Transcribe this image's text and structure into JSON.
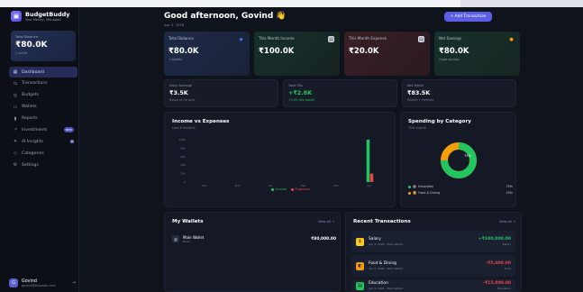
{
  "brand": {
    "name": "BudgetBuddy",
    "tagline": "Your Money, Managed",
    "logo": "wallet-icon"
  },
  "balance_card": {
    "label": "Total Balance",
    "value": "₹80.0K",
    "sub": "1 wallet"
  },
  "nav": [
    {
      "label": "Dashboard",
      "icon": "grid",
      "active": true
    },
    {
      "label": "Transactions",
      "icon": "swap"
    },
    {
      "label": "Budgets",
      "icon": "target"
    },
    {
      "label": "Wallets",
      "icon": "wallet"
    },
    {
      "label": "Reports",
      "icon": "bars"
    },
    {
      "label": "Investments",
      "icon": "trend",
      "badge": "NEW"
    },
    {
      "label": "AI Insights",
      "icon": "spark",
      "dot": true
    },
    {
      "label": "Categories",
      "icon": "tag"
    },
    {
      "label": "Settings",
      "icon": "gear"
    }
  ],
  "user": {
    "name": "Govind",
    "email": "govind@example.com",
    "initial": "G"
  },
  "header": {
    "greeting": "Good afternoon, Govind 👋",
    "date": "Apr 4, 2026",
    "add_button": "+ Add Transaction"
  },
  "stats": [
    {
      "label": "Total Balance",
      "value": "₹80.0K",
      "sub": "1 wallets",
      "icon": "shield-icon",
      "color": "#3b82f6"
    },
    {
      "label": "This Month Income",
      "value": "₹100.0K",
      "sub": "",
      "icon": "doc-icon",
      "color": "#9aa3b8"
    },
    {
      "label": "This Month Expense",
      "value": "₹20.0K",
      "sub": "",
      "icon": "doc-icon",
      "color": "#b8c0d4"
    },
    {
      "label": "Net Savings",
      "value": "₹80.0K",
      "sub": "Good savings",
      "icon": "bag-icon",
      "color": "#f59e0b"
    }
  ],
  "mini": [
    {
      "label": "Daily Average",
      "value": "₹3.5K",
      "sub": "Based on 30 days"
    },
    {
      "label": "Total P&L",
      "value": "+₹2.8K",
      "sub": "+3.5% this month",
      "color": "#22c55e"
    },
    {
      "label": "Net Worth",
      "value": "₹83.5K",
      "sub": "Wallets + Portfolio"
    }
  ],
  "income_chart": {
    "title": "Income vs Expenses",
    "subtitle": "Last 6 months",
    "link": ""
  },
  "chart_data": {
    "type": "bar",
    "title": "Income vs Expenses",
    "categories": [
      "Nov",
      "Dec",
      "Jan",
      "Feb",
      "Mar",
      "Apr"
    ],
    "series": [
      {
        "name": "Income",
        "values": [
          0,
          0,
          0,
          0,
          0,
          100000
        ],
        "color": "#22c55e"
      },
      {
        "name": "Expenses",
        "values": [
          0,
          0,
          0,
          0,
          0,
          20000
        ],
        "color": "#ef4444"
      }
    ],
    "yticks": [
      "100k",
      "80k",
      "60k",
      "40k",
      "20k",
      "0"
    ],
    "ylim": [
      0,
      100000
    ]
  },
  "spending": {
    "title": "Spending by Category",
    "subtitle": "This month",
    "categories": [
      {
        "name": "Education",
        "pct": "75%",
        "value": 75,
        "color": "#22c55e",
        "icon": "📚"
      },
      {
        "name": "Food & Dining",
        "pct": "25%",
        "value": 25,
        "color": "#f59e0b",
        "icon": "🍔"
      }
    ],
    "donut_label": "75%"
  },
  "wallets": {
    "title": "My Wallets",
    "link": "View all →",
    "items": [
      {
        "name": "Main Wallet",
        "type": "Bank",
        "amount": "₹80,000.00"
      }
    ]
  },
  "transactions": {
    "title": "Recent Transactions",
    "link": "View all →",
    "items": [
      {
        "name": "Salary",
        "meta": "Apr 4, 2026 · Main Wallet",
        "amount": "+₹100,000.00",
        "category": "Salary",
        "color": "#22c55e",
        "icon_bg": "#facc15"
      },
      {
        "name": "Food & Dining",
        "meta": "Apr 4, 2026 · Main Wallet",
        "amount": "-₹5,000.00",
        "category": "Food",
        "color": "#ef4444",
        "icon_bg": "#f59e0b"
      },
      {
        "name": "Education",
        "meta": "Apr 4, 2026 · Main Wallet",
        "amount": "-₹15,000.00",
        "category": "Education",
        "color": "#ef4444",
        "icon_bg": "#22c55e"
      }
    ]
  }
}
